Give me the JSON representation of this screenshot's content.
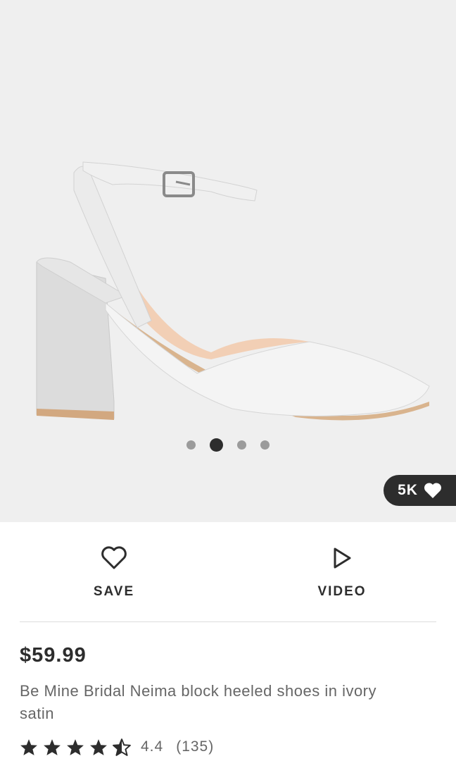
{
  "gallery": {
    "image_alt": "Ivory satin pointed block heel shoe with ankle strap",
    "slide_count": 4,
    "active_slide": 2,
    "likes_label": "5K",
    "colors": {
      "background": "#efefef",
      "dot_inactive": "#9b9b9b",
      "dot_active": "#2d2d2d"
    }
  },
  "actions": {
    "save": {
      "label": "SAVE",
      "icon": "heart-outline-icon"
    },
    "video": {
      "label": "VIDEO",
      "icon": "play-outline-icon"
    }
  },
  "product": {
    "price": "$59.99",
    "title": "Be Mine Bridal Neima block heeled shoes in ivory satin",
    "rating_value": "4.4",
    "rating_count": "(135)",
    "stars": 4.5
  }
}
